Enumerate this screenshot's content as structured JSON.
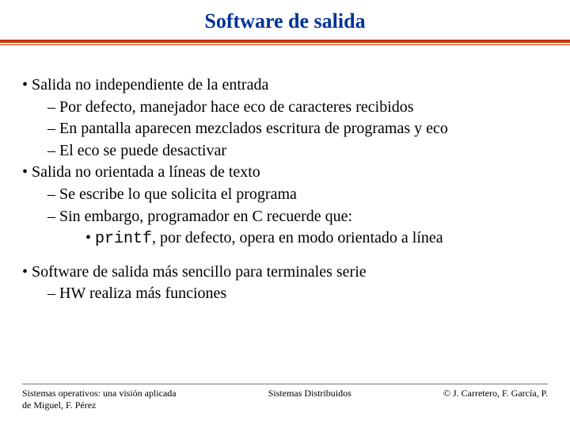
{
  "title": "Software de salida",
  "b1": "Salida no independiente de la entrada",
  "b1_1": "Por defecto, manejador hace eco de caracteres recibidos",
  "b1_2": "En pantalla aparecen mezclados escritura de programas y eco",
  "b1_3": "El eco se puede desactivar",
  "b2": "Salida no orientada a líneas de texto",
  "b2_1": "Se escribe lo que solicita el programa",
  "b2_2": "Sin embargo, programador en C recuerde que:",
  "b2_2_1_code": "printf",
  "b2_2_1_rest": ", por defecto, opera en modo orientado a línea",
  "b3": "Software de salida más sencillo para terminales serie",
  "b3_1": "HW realiza más funciones",
  "footer": {
    "left_line1": "Sistemas operativos: una visión aplicada",
    "left_line2": "de Miguel, F. Pérez",
    "center": "Sistemas Distribuidos",
    "right": "© J. Carretero, F. García, P."
  }
}
